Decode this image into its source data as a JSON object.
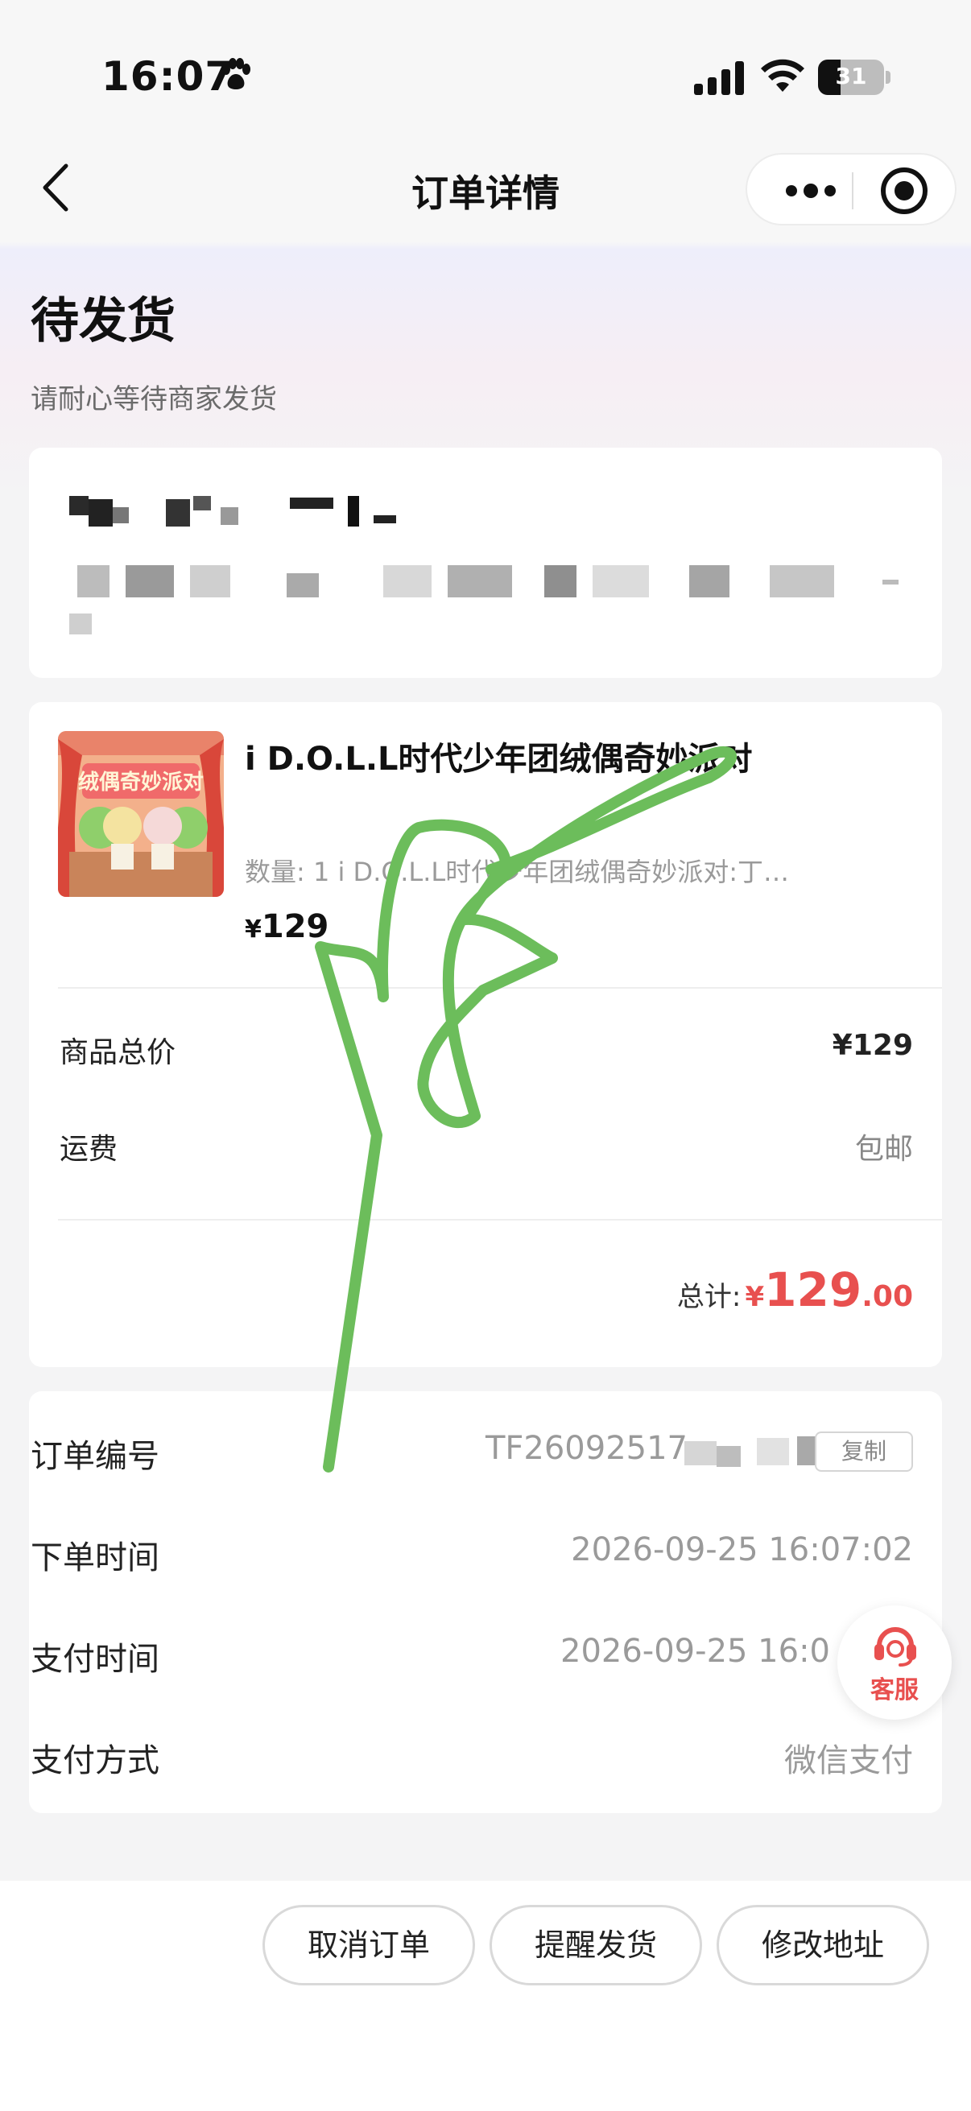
{
  "status_bar": {
    "time": "16:07",
    "battery": "31",
    "icons": [
      "paw-icon",
      "signal-icon",
      "wifi-icon",
      "battery-icon"
    ]
  },
  "nav": {
    "title": "订单详情",
    "back_icon": "chevron-left-icon",
    "more_icon": "more-dots-icon",
    "close_icon": "target-close-icon"
  },
  "order_status": {
    "title": "待发货",
    "hint": "请耐心等待商家发货"
  },
  "goods": {
    "image_text": "绒偶奇妙派对",
    "title": "i D.O.L.L时代少年团绒偶奇妙派对",
    "spec": "数量: 1   i D.O.L.L时代少年团绒偶奇妙派对:丁…",
    "price_symbol": "¥",
    "price": "129"
  },
  "summary": {
    "subtotal_label": "商品总价",
    "subtotal_value": "¥129",
    "shipping_label": "运费",
    "shipping_value": "包邮",
    "total_label": "总计:",
    "total_symbol": "¥",
    "total_int": "129",
    "total_dec": ".00"
  },
  "order_info": {
    "number_label": "订单编号",
    "number_value": "TF26092517",
    "copy_label": "复制",
    "created_label": "下单时间",
    "created_value": "2026-09-25 16:07:02",
    "paid_label": "支付时间",
    "paid_value": "2026-09-25 16:0",
    "method_label": "支付方式",
    "method_value": "微信支付"
  },
  "service": {
    "label": "客服",
    "icon": "headset-icon"
  },
  "actions": {
    "cancel": "取消订单",
    "remind": "提醒发货",
    "modify_address": "修改地址"
  },
  "colors": {
    "accent_red": "#e8504f",
    "scribble_green": "#6cbd5b",
    "page_bg": "#f4f4f5"
  }
}
